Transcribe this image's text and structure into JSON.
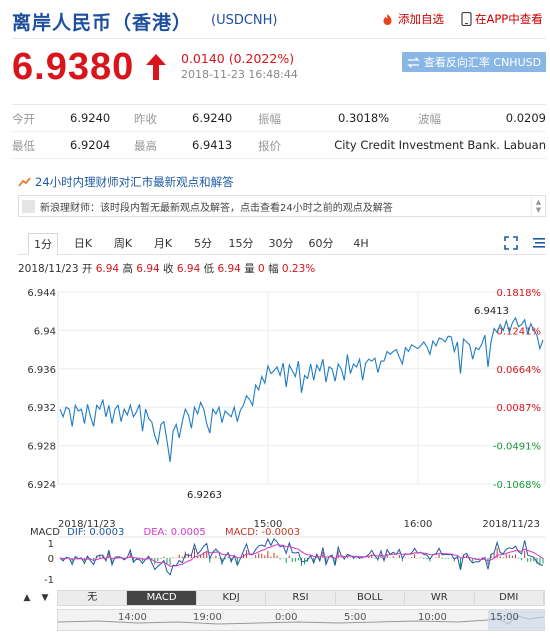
{
  "header": {
    "title": "离岸人民币（香港）",
    "symbol": "(USDCNH)",
    "add_favorite": "添加自选",
    "app_view": "在APP中查看"
  },
  "quote": {
    "price": "6.9380",
    "change": "0.0140 (0.2022%)",
    "datetime": "2018-11-23 16:48:44",
    "reverse_button": "查看反向汇率 CNHUSD"
  },
  "stats": {
    "open_label": "今开",
    "open": "6.9240",
    "prev_close_label": "昨收",
    "prev_close": "6.9240",
    "amplitude_label": "振幅",
    "amplitude": "0.3018%",
    "volatility_label": "波幅",
    "volatility": "0.0209",
    "low_label": "最低",
    "low": "6.9204",
    "high_label": "最高",
    "high": "6.9413",
    "quote_label": "报价",
    "quote_source": "City Credit Investment Bank. Labuan"
  },
  "advisor": {
    "heading": "24小时内理财师对汇市最新观点和解答",
    "message": "新浪理财师：该时段内暂无最新观点及解答，点击查看24小时之前的观点及解答"
  },
  "tabs": [
    "1分",
    "日K",
    "周K",
    "月K",
    "5分",
    "15分",
    "30分",
    "60分",
    "4H"
  ],
  "ohlc": {
    "date": "2018/11/23",
    "open_label": "开",
    "open": "6.94",
    "high_label": "高",
    "high": "6.94",
    "close_label": "收",
    "close": "6.94",
    "low_label": "低",
    "low": "6.94",
    "volume_label": "量",
    "volume": "0",
    "range_label": "幅",
    "range": "0.23%"
  },
  "macd_legend": {
    "label": "MACD",
    "dif": "DIF: 0.0003",
    "dea": "DEA: 0.0005",
    "macd": "MACD: -0.0003"
  },
  "indicator_tabs": [
    "无",
    "MACD",
    "KDJ",
    "RSI",
    "BOLL",
    "WR",
    "DMI"
  ],
  "navigator_labels": [
    "14:00",
    "19:00",
    "0:00",
    "5:00",
    "10:00",
    "15:00"
  ],
  "colors": {
    "up": "#d9141b",
    "down": "#1a9a3a",
    "line": "#1f7cc4",
    "brand": "#1e4f9e"
  },
  "chart_data": {
    "type": "line",
    "x_tick_labels": [
      "2018/11/23",
      "15:00",
      "16:00",
      "2018/11/23"
    ],
    "y_ticks": [
      "6.944",
      "6.94",
      "6.936",
      "6.932",
      "6.928",
      "6.924"
    ],
    "y_ticks_pct": [
      "0.1818%",
      "0.1241%",
      "0.0664%",
      "0.0087%",
      "-0.0491%",
      "-0.1068%"
    ],
    "ylim": [
      6.924,
      6.944
    ],
    "max_annotation": "6.9413",
    "min_annotation": "6.9263",
    "values": [
      6.9318,
      6.931,
      6.932,
      6.9318,
      6.93,
      6.9322,
      6.9316,
      6.9318,
      6.9303,
      6.9323,
      6.931,
      6.93,
      6.9322,
      6.9318,
      6.9328,
      6.931,
      6.9322,
      6.9303,
      6.9318,
      6.9322,
      6.9305,
      6.9318,
      6.9312,
      6.9322,
      6.931,
      6.9315,
      6.9323,
      6.9295,
      6.9318,
      6.9308,
      6.9305,
      6.929,
      6.9282,
      6.9302,
      6.9305,
      6.9285,
      6.9263,
      6.9295,
      6.9302,
      6.9288,
      6.9305,
      6.9318,
      6.9312,
      6.9298,
      6.932,
      6.9313,
      6.9325,
      6.9318,
      6.9303,
      6.9293,
      6.9318,
      6.9313,
      6.932,
      6.9304,
      6.9316,
      6.9313,
      6.931,
      6.932,
      6.9305,
      6.9317,
      6.9322,
      6.9332,
      6.9328,
      6.9322,
      6.9343,
      6.9338,
      6.9352,
      6.9345,
      6.9363,
      6.9355,
      6.9358,
      6.9362,
      6.9353,
      6.9366,
      6.9341,
      6.9364,
      6.9358,
      6.9352,
      6.9368,
      6.9335,
      6.9353,
      6.935,
      6.9365,
      6.9348,
      6.9364,
      6.9358,
      6.937,
      6.9346,
      6.9362,
      6.936,
      6.9347,
      6.9365,
      6.936,
      6.9348,
      6.9375,
      6.9355,
      6.9365,
      6.9362,
      6.937,
      6.9348,
      6.9366,
      6.937,
      6.9368,
      6.9371,
      6.9356,
      6.9368,
      6.9368,
      6.9378,
      6.9375,
      6.9378,
      6.938,
      6.9372,
      6.9365,
      6.9382,
      6.9378,
      6.9385,
      6.9383,
      6.9381,
      6.9384,
      6.9388,
      6.9383,
      6.9375,
      6.9389,
      6.9384,
      6.9392,
      6.9391,
      6.9388,
      6.9394,
      6.9393,
      6.9378,
      6.9388,
      6.9355,
      6.9391,
      6.9388,
      6.9385,
      6.937,
      6.9382,
      6.938,
      6.9386,
      6.9395,
      6.9362,
      6.9388,
      6.9402,
      6.9398,
      6.9406,
      6.94,
      6.941,
      6.9398,
      6.9408,
      6.9413,
      6.9404,
      6.9406,
      6.9411,
      6.9396,
      6.9407,
      6.94,
      6.9395,
      6.9381,
      6.939
    ]
  }
}
